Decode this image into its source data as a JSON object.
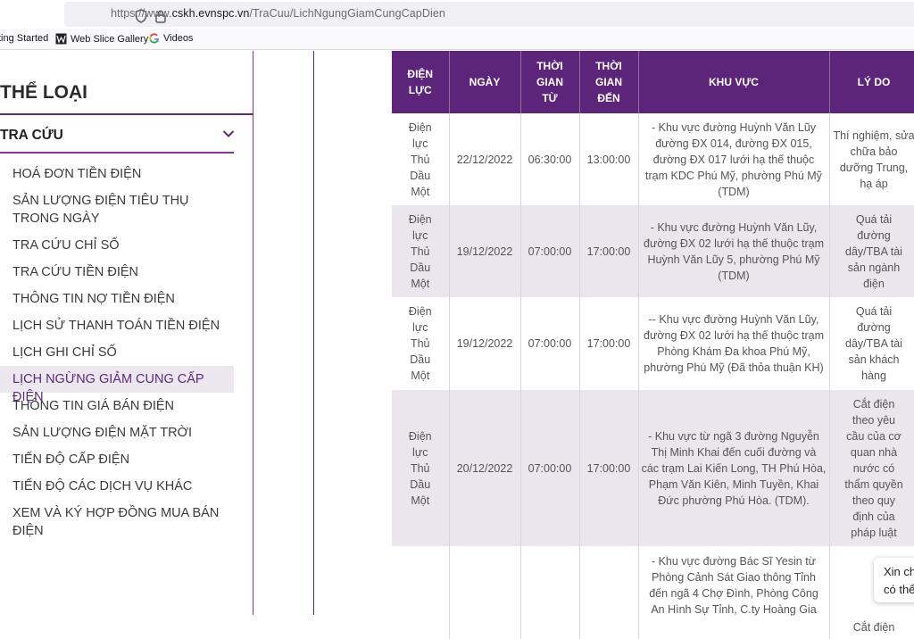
{
  "browser": {
    "url_prefix": "https://www.",
    "url_domain": "cskh.evnspc.vn",
    "url_path": "/TraCuu/LichNgungGiamCungCapDien",
    "bookmarks": [
      {
        "label": "ting Started",
        "icon": "firefox-icon"
      },
      {
        "label": "Web Slice Gallery",
        "icon": "web-slice-icon"
      },
      {
        "label": "Videos",
        "icon": "google-icon"
      }
    ]
  },
  "sidebar": {
    "title": "THỂ LOẠI",
    "section": "TRA CỨU",
    "items": [
      {
        "label": "HOÁ ĐƠN TIỀN ĐIỆN"
      },
      {
        "label": "SẢN LƯỢNG ĐIỆN TIÊU THỤ TRONG NGÀY"
      },
      {
        "label": "TRA CỨU CHỈ SỐ"
      },
      {
        "label": "TRA CỨU TIỀN ĐIỆN"
      },
      {
        "label": "THÔNG TIN NỢ TIỀN ĐIỆN"
      },
      {
        "label": "LỊCH SỬ THANH TOÁN TIỀN ĐIỆN"
      },
      {
        "label": "LỊCH GHI CHỈ SỐ"
      },
      {
        "label": "LỊCH NGỪNG GIẢM CUNG CẤP ĐIỆN",
        "active": true
      },
      {
        "label": "THÔNG TIN GIÁ BÁN ĐIỆN"
      },
      {
        "label": "SẢN LƯỢNG ĐIỆN MẶT TRỜI"
      },
      {
        "label": "TIẾN ĐỘ CẤP ĐIỆN"
      },
      {
        "label": "TIẾN ĐỘ CÁC DỊCH VỤ KHÁC"
      },
      {
        "label": "XEM VÀ KÝ HỢP ĐỒNG MUA BÁN ĐIỆN"
      }
    ]
  },
  "table": {
    "headers": [
      "ĐIỆN LỰC",
      "NGÀY",
      "THỜI GIAN TỪ",
      "THỜI GIAN ĐẾN",
      "KHU VỰC",
      "LÝ DO"
    ],
    "rows": [
      [
        "Điện lực Thủ Dầu Một",
        "22/12/2022",
        "06:30:00",
        "13:00:00",
        "- Khu vực đường Huỳnh Văn Lũy đường ĐX 014, đường ĐX 015, đường ĐX 017 lưới hạ thế thuộc trạm KDC Phú Mỹ, phường Phú Mỹ (TDM)",
        "Thí nghiệm, sửa chữa bảo dưỡng Trung, hạ áp"
      ],
      [
        "Điện lực Thủ Dầu Một",
        "19/12/2022",
        "07:00:00",
        "17:00:00",
        "- Khu vực đường Huỳnh Văn Lũy, đường ĐX 02 lưới hạ thế thuộc trạm Huỳnh Văn Lũy 5, phường Phú Mỹ (TDM)",
        "Quá tải đường dây/TBA tài sản ngành điện"
      ],
      [
        "Điện lực Thủ Dầu Một",
        "19/12/2022",
        "07:00:00",
        "17:00:00",
        "-- Khu vực đường Huỳnh Văn Lũy, đường ĐX 02 lưới hạ thế thuộc trạm Phòng Khám Đa khoa Phú Mỹ, phường Phú Mỹ (Đã thỏa thuận KH)",
        "Quá tải đường dây/TBA tài sản khách hàng"
      ],
      [
        "Điện lực Thủ Dầu Một",
        "20/12/2022",
        "07:00:00",
        "17:00:00",
        "- Khu vực từ ngã 3 đường Nguyễn Thị Minh Khai đến cuối đường và các trạm Lai Kiến Long, TH Phú Hòa, Phạm Văn Kiên, Minh Tuyền, Khai Đức phường Phú Hòa. (TDM).",
        "Cắt điện theo yêu cầu của cơ quan nhà nước có thẩm quyền theo quy định của pháp luật"
      ],
      [
        "",
        "",
        "",
        "",
        "- Khu vực đường Bác Sĩ Yesin từ Phòng Cảnh Sát Giao thông Tỉnh đến ngã 4 Chợ Đình, Phòng Công An Hình Sự Tỉnh, C.ty Hoàng Gia",
        "Cắt điện"
      ]
    ]
  },
  "chat_widget": {
    "line1": "Xin ch",
    "line2": "có thể"
  }
}
